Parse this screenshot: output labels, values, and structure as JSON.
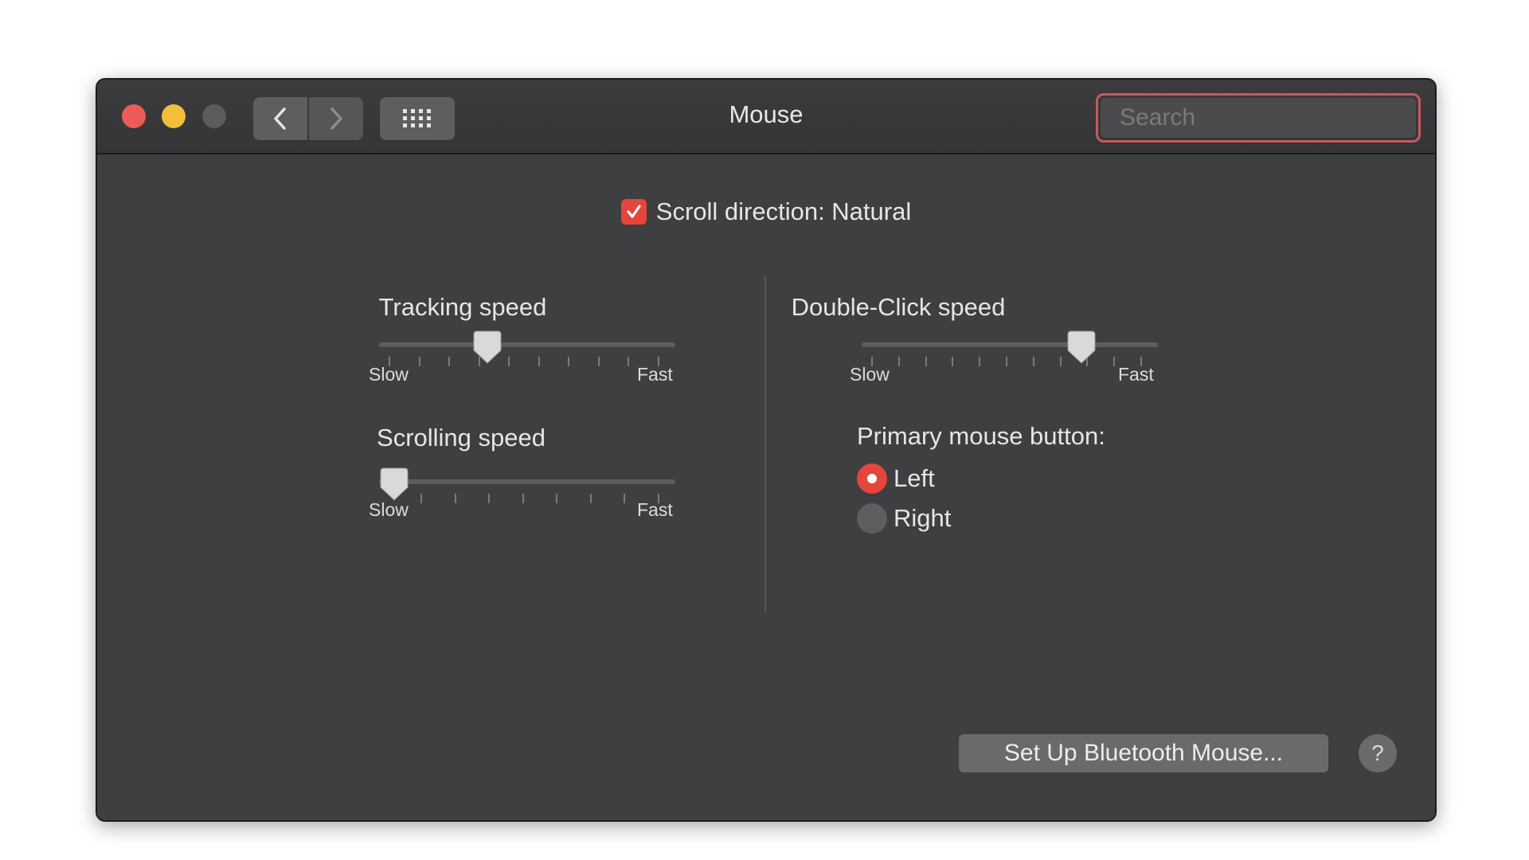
{
  "window": {
    "title": "Mouse"
  },
  "toolbar": {
    "back_icon": "chevron-left-icon",
    "forward_icon": "chevron-right-icon",
    "grid_icon": "grid-icon"
  },
  "search": {
    "placeholder": "Search",
    "value": ""
  },
  "scroll_direction": {
    "label": "Scroll direction: Natural",
    "checked": true
  },
  "tracking": {
    "title": "Tracking speed",
    "min_label": "Slow",
    "max_label": "Fast",
    "value": 0.35,
    "ticks": 10
  },
  "scrolling": {
    "title": "Scrolling speed",
    "min_label": "Slow",
    "max_label": "Fast",
    "value": 0.0,
    "ticks": 8
  },
  "double_click": {
    "title": "Double-Click speed",
    "min_label": "Slow",
    "max_label": "Fast",
    "value": 0.77,
    "ticks": 11
  },
  "primary_button": {
    "title": "Primary mouse button:",
    "options": [
      {
        "label": "Left",
        "selected": true
      },
      {
        "label": "Right",
        "selected": false
      }
    ]
  },
  "bluetooth_button": {
    "label": "Set Up Bluetooth Mouse..."
  },
  "help": {
    "label": "?"
  },
  "colors": {
    "accent": "#e6453c",
    "window_bg": "#3f3e40",
    "search_focus": "#c9595f"
  }
}
